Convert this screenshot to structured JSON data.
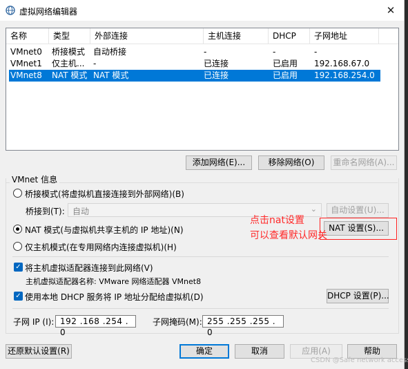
{
  "window": {
    "title": "虚拟网络编辑器",
    "close_glyph": "✕"
  },
  "list": {
    "columns": [
      "名称",
      "类型",
      "外部连接",
      "主机连接",
      "DHCP",
      "子网地址"
    ],
    "rows": [
      {
        "name": "VMnet0",
        "type": "桥接模式",
        "external": "自动桥接",
        "host": "-",
        "dhcp": "-",
        "subnet": "-"
      },
      {
        "name": "VMnet1",
        "type": "仅主机...",
        "external": "-",
        "host": "已连接",
        "dhcp": "已启用",
        "subnet": "192.168.67.0"
      },
      {
        "name": "VMnet8",
        "type": "NAT 模式",
        "external": "NAT 模式",
        "host": "已连接",
        "dhcp": "已启用",
        "subnet": "192.168.254.0"
      }
    ],
    "selected_row": "VMnet8"
  },
  "list_buttons": {
    "add": "添加网络(E)...",
    "remove": "移除网络(O)",
    "rename": "重命名网络(A)..."
  },
  "vmnet_info": {
    "group_title": "VMnet 信息",
    "bridge_radio": "桥接模式(将虚拟机直接连接到外部网络)(B)",
    "bridge_to_label": "桥接到(T):",
    "bridge_to_value": "自动",
    "auto_settings": "自动设置(U)...",
    "nat_radio": "NAT 模式(与虚拟机共享主机的 IP 地址)(N)",
    "nat_settings": "NAT 设置(S)...",
    "host_only_radio": "仅主机模式(在专用网络内连接虚拟机)(H)",
    "connect_adapter": "将主机虚拟适配器连接到此网络(V)",
    "adapter_name": "主机虚拟适配器名称: VMware 网络适配器 VMnet8",
    "use_dhcp": "使用本地 DHCP 服务将 IP 地址分配给虚拟机(D)",
    "dhcp_settings": "DHCP 设置(P)...",
    "subnet_ip_label": "子网 IP (I):",
    "subnet_ip": "192 .168 .254 . 0",
    "subnet_mask_label": "子网掩码(M):",
    "subnet_mask": "255 .255 .255 . 0"
  },
  "footer": {
    "restore": "还原默认设置(R)",
    "ok": "确定",
    "cancel": "取消",
    "apply": "应用(A)",
    "help": "帮助"
  },
  "annotation": {
    "line1": "点击nat设置",
    "line2": "可以查看默认网关"
  },
  "watermark": "CSDN @Safe network access",
  "colors": {
    "selection": "#0078d7",
    "annotation": "#ff2020"
  }
}
